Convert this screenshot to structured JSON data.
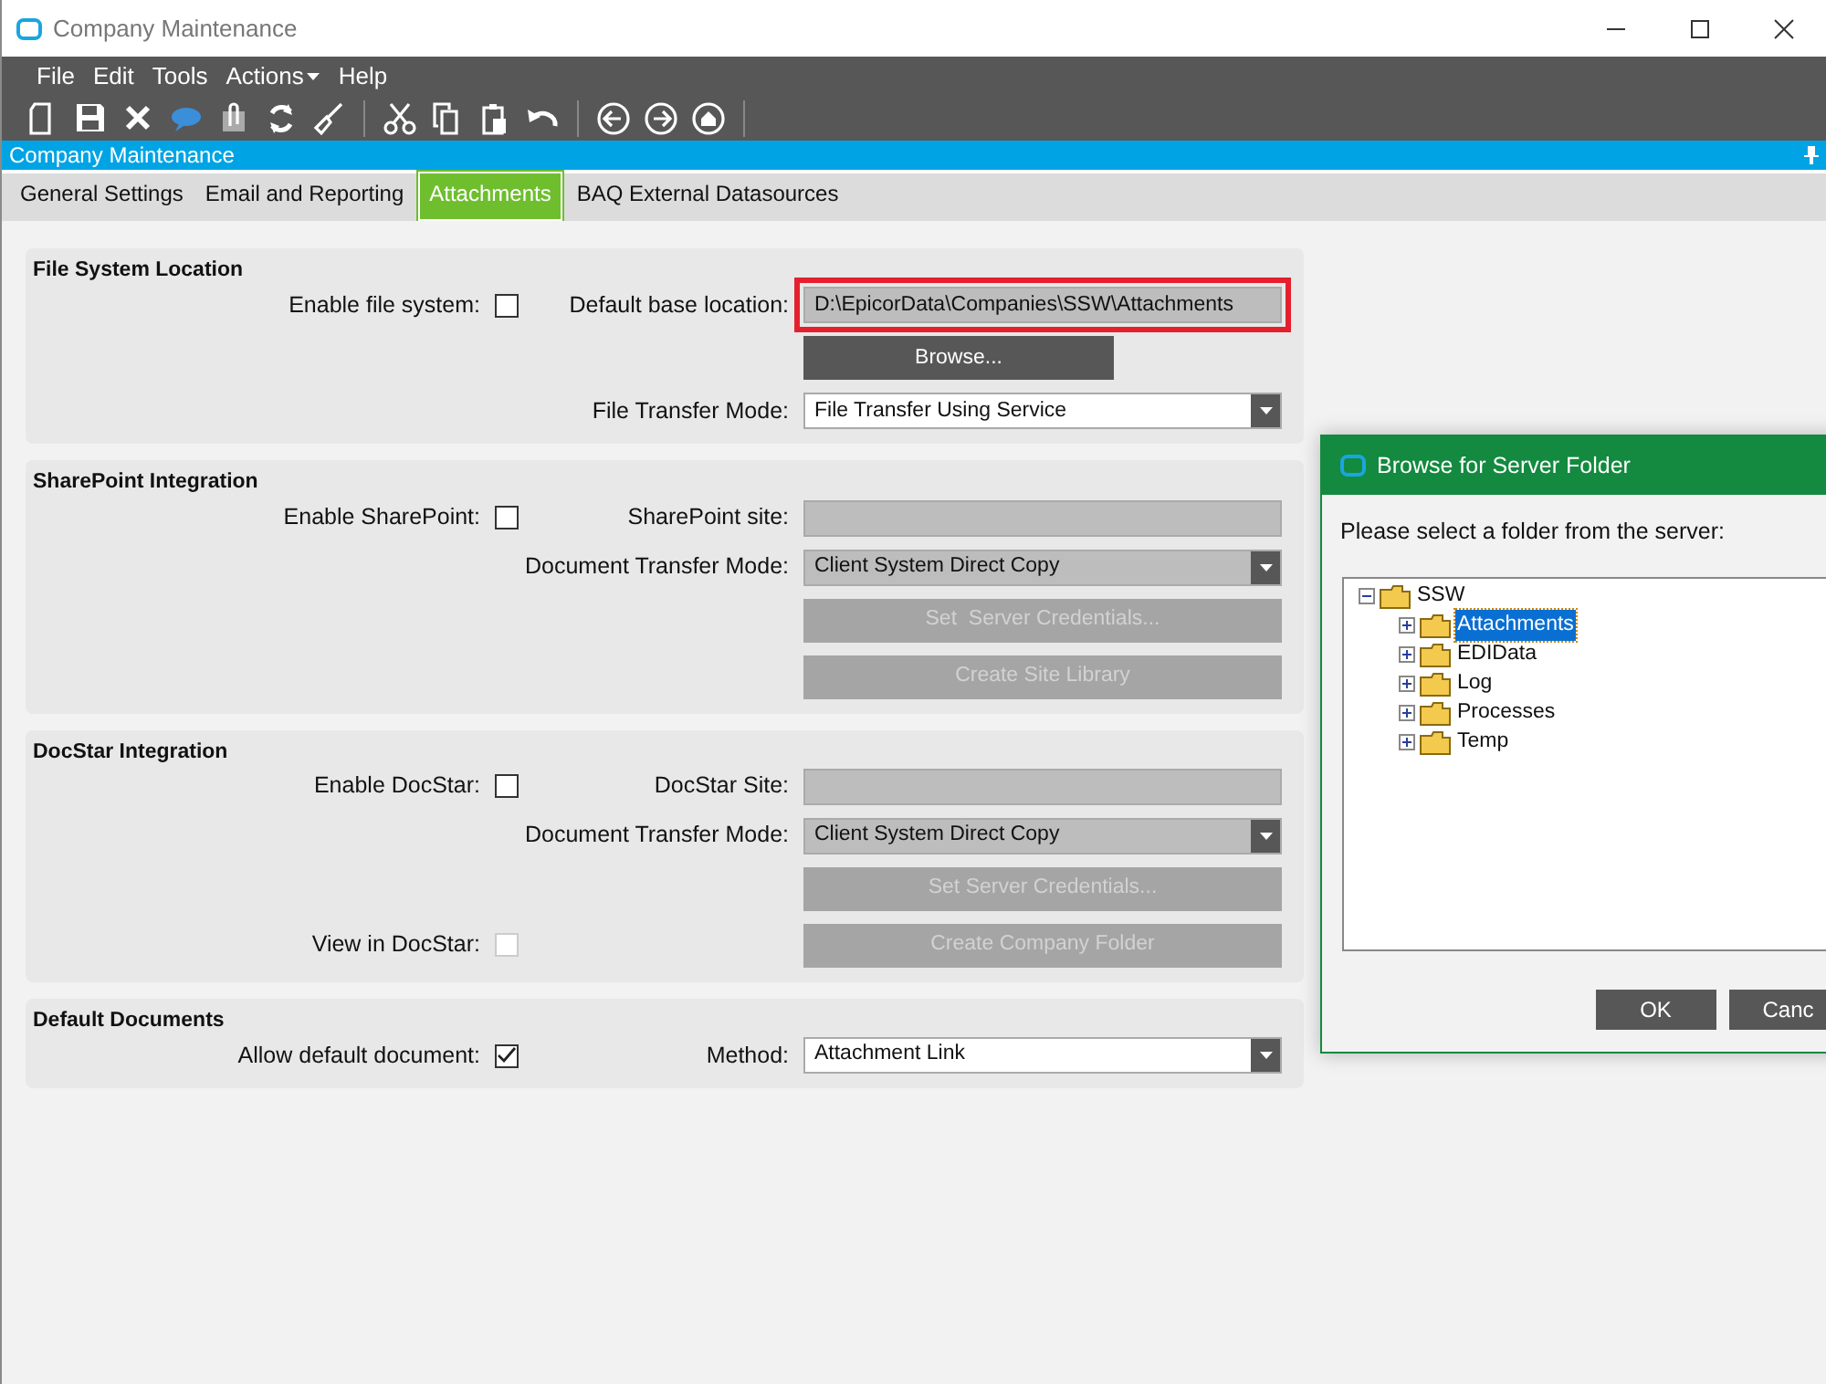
{
  "window": {
    "title": "Company Maintenance"
  },
  "menu": [
    {
      "label": "File",
      "dropdown": false
    },
    {
      "label": "Edit",
      "dropdown": false
    },
    {
      "label": "Tools",
      "dropdown": false
    },
    {
      "label": "Actions",
      "dropdown": true
    },
    {
      "label": "Help",
      "dropdown": false
    }
  ],
  "header": {
    "title": "Company Maintenance"
  },
  "tabs": [
    {
      "label": "General Settings",
      "selected": false
    },
    {
      "label": "Email and Reporting",
      "selected": false
    },
    {
      "label": "Attachments",
      "selected": true
    },
    {
      "label": "BAQ External Datasources",
      "selected": false
    }
  ],
  "groups": [
    {
      "title": "File System Location",
      "rows": [
        {
          "left_label": "Enable file system:",
          "checkbox": {
            "checked": false,
            "disabled": false
          },
          "right_label": "Default base location:",
          "control": {
            "kind": "field",
            "value": "D:\\EpicorData\\Companies\\SSW\\Attachments",
            "disabled": true,
            "highlighted": true
          }
        },
        {
          "control": {
            "kind": "button",
            "label": "Browse...",
            "disabled": false
          }
        },
        {
          "right_label": "File Transfer Mode:",
          "control": {
            "kind": "select",
            "value": "File Transfer Using Service",
            "disabled": false
          }
        }
      ]
    },
    {
      "title": "SharePoint Integration",
      "rows": [
        {
          "left_label": "Enable SharePoint:",
          "checkbox": {
            "checked": false,
            "disabled": false
          },
          "right_label": "SharePoint site:",
          "control": {
            "kind": "field",
            "disabled": true
          }
        },
        {
          "right_label": "Document Transfer Mode:",
          "control": {
            "kind": "select",
            "value": "Client System Direct Copy",
            "disabled": true
          }
        },
        {
          "control": {
            "kind": "button",
            "label": "Set  Server Credentials...",
            "disabled": true
          }
        },
        {
          "control": {
            "kind": "button",
            "label": "Create Site Library",
            "disabled": true
          }
        }
      ]
    },
    {
      "title": "DocStar Integration",
      "rows": [
        {
          "left_label": "Enable DocStar:",
          "checkbox": {
            "checked": false,
            "disabled": false
          },
          "right_label": "DocStar Site:",
          "control": {
            "kind": "field",
            "disabled": true
          }
        },
        {
          "right_label": "Document Transfer Mode:",
          "control": {
            "kind": "select",
            "value": "Client System Direct Copy",
            "disabled": true
          }
        },
        {
          "control": {
            "kind": "button",
            "label": "Set Server Credentials...",
            "disabled": true
          }
        },
        {
          "left_label": "View in DocStar:",
          "checkbox": {
            "checked": false,
            "disabled": true
          },
          "control": {
            "kind": "button",
            "label": "Create Company Folder",
            "disabled": true
          }
        }
      ]
    },
    {
      "title": "Default Documents",
      "rows": [
        {
          "left_label": "Allow default document:",
          "checkbox": {
            "checked": true,
            "disabled": false
          },
          "right_label": "Method:",
          "control": {
            "kind": "select",
            "value": "Attachment Link",
            "disabled": false
          }
        }
      ]
    }
  ],
  "dialog": {
    "title": "Browse for Server Folder",
    "prompt": "Please select a folder from the server:",
    "tree": [
      {
        "label": "SSW",
        "expanded": true,
        "selected": false,
        "children": [
          {
            "label": "Attachments",
            "expanded": false,
            "selected": true
          },
          {
            "label": "EDIData",
            "expanded": false,
            "selected": false
          },
          {
            "label": "Log",
            "expanded": false,
            "selected": false
          },
          {
            "label": "Processes",
            "expanded": false,
            "selected": false
          },
          {
            "label": "Temp",
            "expanded": false,
            "selected": false
          }
        ]
      }
    ],
    "buttons": [
      "OK",
      "Canc"
    ]
  }
}
